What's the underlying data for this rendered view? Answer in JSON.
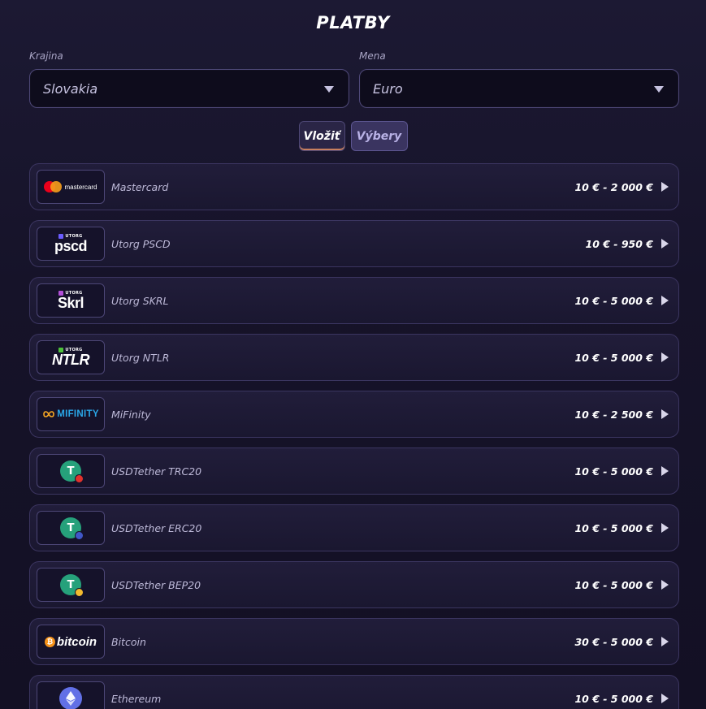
{
  "header": {
    "title": "PLATBY"
  },
  "filters": {
    "country_label": "Krajina",
    "country_value": "Slovakia",
    "currency_label": "Mena",
    "currency_value": "Euro"
  },
  "tabs": [
    {
      "label": "Vložiť",
      "active": true
    },
    {
      "label": "Výbery",
      "active": false
    }
  ],
  "methods": [
    {
      "name": "Mastercard",
      "range": "10 € - 2 000 €",
      "logo": {
        "icon": "mastercard-logo",
        "text": "mastercard"
      }
    },
    {
      "name": "Utorg PSCD",
      "range": "10 € - 950 €",
      "logo": {
        "icon": "utorg-pscd-logo",
        "top": "UTORG",
        "main": "pscd",
        "color": "#6b5cff"
      }
    },
    {
      "name": "Utorg SKRL",
      "range": "10 € - 5 000 €",
      "logo": {
        "icon": "utorg-skrl-logo",
        "top": "UTORG",
        "main": "Skrl",
        "color": "#b24fd8"
      }
    },
    {
      "name": "Utorg NTLR",
      "range": "10 € - 5 000 €",
      "logo": {
        "icon": "utorg-ntlr-logo",
        "top": "UTORG",
        "main": "NTLR",
        "color": "#4ec23a"
      }
    },
    {
      "name": "MiFinity",
      "range": "10 € - 2 500 €",
      "logo": {
        "icon": "mifinity-logo",
        "text": "MIFINITY"
      }
    },
    {
      "name": "USDTether TRC20",
      "range": "10 € - 5 000 €",
      "logo": {
        "icon": "tether-trc20-icon",
        "badge_color": "#e0322c"
      }
    },
    {
      "name": "USDTether ERC20",
      "range": "10 € - 5 000 €",
      "logo": {
        "icon": "tether-erc20-icon",
        "badge_color": "#4057c8"
      }
    },
    {
      "name": "USDTether BEP20",
      "range": "10 € - 5 000 €",
      "logo": {
        "icon": "tether-bep20-icon",
        "badge_color": "#f3ba2f"
      }
    },
    {
      "name": "Bitcoin",
      "range": "30 € - 5 000 €",
      "logo": {
        "icon": "bitcoin-logo",
        "text": "bitcoin"
      }
    },
    {
      "name": "Ethereum",
      "range": "10 € - 5 000 €",
      "logo": {
        "icon": "ethereum-icon"
      }
    }
  ]
}
